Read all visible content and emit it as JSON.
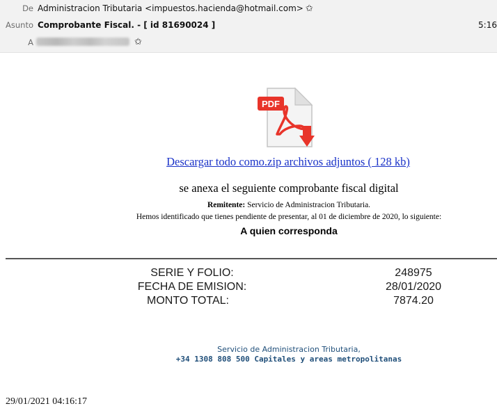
{
  "header": {
    "from": {
      "label": "De",
      "value": "Administracion Tributaria <impuestos.hacienda@hotmail.com>"
    },
    "subject": {
      "label": "Asunto",
      "value": "Comprobante Fiscal. - [ id 81690024 ]"
    },
    "to": {
      "label": "A"
    },
    "time": "5:16",
    "star_icon": "star-icon"
  },
  "body": {
    "pdf_badge": "PDF",
    "download_link": "Descargar todo como.zip archivos adjuntos ( 128 kb)",
    "line1": "se anexa el seguiente comprobante fiscal digital",
    "sender_label": "Remitente:",
    "sender_value": " Servicio de Administracion Tributaria.",
    "line3": "Hemos identificado que tienes pendiente de presentar, al 01 de diciembre de 2020, lo siguiente:",
    "line4": "A quien corresponda"
  },
  "details": [
    {
      "label": "SERIE Y FOLIO:",
      "value": "248975"
    },
    {
      "label": "FECHA DE EMISION:",
      "value": "28/01/2020"
    },
    {
      "label": "MONTO TOTAL:",
      "value": "7874.20"
    }
  ],
  "footer": {
    "line1": "Servicio de Administracion Tributaria,",
    "line2": "+34 1308 808 500 Capitales y areas metropolitanas"
  },
  "timestamp": "29/01/2021 04:16:17",
  "colors": {
    "link": "#1a32c8",
    "footer": "#1f4e79",
    "pdf_red": "#e8342a"
  }
}
